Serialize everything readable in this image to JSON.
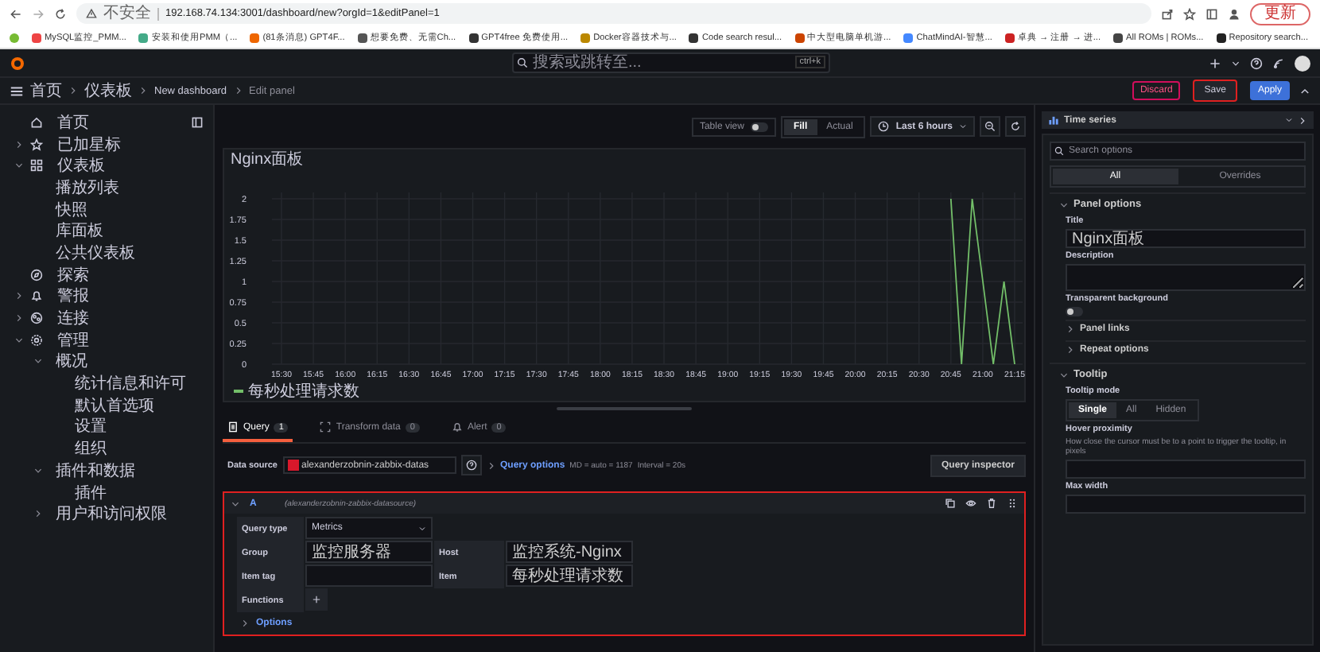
{
  "browser": {
    "security": "不安全",
    "url": "192.168.74.134:3001/dashboard/new?orgId=1&editPanel=1",
    "update_button": "更新",
    "bookmarks": [
      "MySQL监控_PMM...",
      "安装和使用PMM（...",
      "(81条消息) GPT4F...",
      "想要免费、无需Ch...",
      "GPT4free 免费使用...",
      "Docker容器技术与...",
      "Code search resul...",
      "中大型电脑单机游...",
      "ChatMindAI-智慧...",
      "卓典 → 注册 → 进...",
      "All ROMs | ROMs...",
      "Repository search..."
    ]
  },
  "topbar": {
    "search_placeholder": "搜索或跳转至...",
    "shortcut": "ctrl+k"
  },
  "breadcrumbs": [
    "首页",
    "仪表板",
    "New dashboard",
    "Edit panel"
  ],
  "header_actions": [
    {
      "label": "Discard",
      "kind": "destructive",
      "highlighted": false
    },
    {
      "label": "Save",
      "kind": "secondary",
      "highlighted": true
    },
    {
      "label": "Apply",
      "kind": "primary",
      "highlighted": false
    }
  ],
  "sidebar": {
    "items": [
      {
        "label": "首页",
        "kind": "home"
      },
      {
        "label": "已加星标",
        "kind": "star",
        "expanded": false
      },
      {
        "label": "仪表板",
        "kind": "grid",
        "expanded": true,
        "children": [
          {
            "label": "播放列表"
          },
          {
            "label": "快照"
          },
          {
            "label": "库面板"
          },
          {
            "label": "公共仪表板"
          }
        ]
      },
      {
        "label": "探索",
        "kind": "compass"
      },
      {
        "label": "警报",
        "kind": "bell",
        "expanded": false
      },
      {
        "label": "连接",
        "kind": "link",
        "expanded": false
      },
      {
        "label": "管理",
        "kind": "gear",
        "expanded": true,
        "children": [
          {
            "label": "概况",
            "expanded": true,
            "children": [
              {
                "label": "统计信息和许可"
              },
              {
                "label": "默认首选项"
              },
              {
                "label": "设置"
              },
              {
                "label": "组织"
              }
            ]
          },
          {
            "label": "插件和数据",
            "expanded": true,
            "children": [
              {
                "label": "插件"
              }
            ]
          },
          {
            "label": "用户和访问权限",
            "expanded": false
          }
        ]
      }
    ]
  },
  "toolbar": {
    "table_view": {
      "label": "Table view",
      "on": false
    },
    "size_modes": [
      {
        "label": "Fill",
        "selected": true
      },
      {
        "label": "Actual",
        "selected": false
      }
    ],
    "time_range": "Last 6 hours"
  },
  "panel": {
    "title": "Nginx面板",
    "chart_data": {
      "type": "line",
      "categories": [
        "15:30",
        null,
        null,
        "15:45",
        null,
        null,
        "16:00",
        null,
        null,
        "16:15",
        null,
        null,
        "16:30",
        null,
        null,
        "16:45",
        null,
        null,
        "17:00",
        null,
        null,
        "17:15",
        null,
        null,
        "17:30",
        null,
        null,
        "17:45",
        null,
        null,
        "18:00",
        null,
        null,
        "18:15",
        null,
        null,
        "18:30",
        null,
        null,
        "18:45",
        null,
        null,
        "19:00",
        null,
        null,
        "19:15",
        null,
        null,
        "19:30",
        null,
        null,
        "19:45",
        null,
        null,
        "20:00",
        null,
        null,
        "20:15",
        null,
        null,
        "20:30",
        null,
        null,
        "20:45",
        null,
        null,
        "21:00",
        null,
        null,
        "21:15"
      ],
      "series": [
        {
          "name": "每秒处理请求数",
          "color": "#73bf69",
          "values": [
            null,
            null,
            null,
            null,
            null,
            null,
            null,
            null,
            null,
            null,
            null,
            null,
            null,
            null,
            null,
            null,
            null,
            null,
            null,
            null,
            null,
            null,
            null,
            null,
            null,
            null,
            null,
            null,
            null,
            null,
            null,
            null,
            null,
            null,
            null,
            null,
            null,
            null,
            null,
            null,
            null,
            null,
            null,
            null,
            null,
            null,
            null,
            null,
            null,
            null,
            null,
            null,
            null,
            null,
            null,
            null,
            null,
            null,
            null,
            null,
            null,
            null,
            null,
            2,
            0,
            2,
            1,
            0,
            1,
            0
          ]
        }
      ],
      "ylim": [
        0,
        2
      ],
      "grid": true,
      "yticks": [
        0,
        0.25,
        0.5,
        0.75,
        1,
        1.25,
        1.5,
        1.75,
        2
      ]
    }
  },
  "query_editor": {
    "tabs": [
      {
        "label": "Query",
        "count": "1",
        "kind": "query",
        "selected": true
      },
      {
        "label": "Transform data",
        "count": "0",
        "kind": "transform",
        "selected": false
      },
      {
        "label": "Alert",
        "count": "0",
        "kind": "alert",
        "selected": false
      }
    ],
    "data_source": {
      "label": "Data source",
      "value": "alexanderzobnin-zabbix-datas",
      "query_options": "Query options",
      "max_data_points": "MD = auto = 1187",
      "interval": "Interval = 20s",
      "inspector": "Query inspector"
    },
    "query": {
      "ref": "A",
      "source": "(alexanderzobnin-zabbix-datasource)",
      "expanded": true,
      "highlighted": true,
      "query_type": {
        "label": "Query type",
        "value": "Metrics"
      },
      "field_rows": [
        [
          {
            "label": "Group",
            "value": "监控服务器"
          },
          {
            "label": "Host",
            "value": "监控系统-Nginx"
          }
        ],
        [
          {
            "label": "Item tag"
          },
          {
            "label": "Item",
            "value": "每秒处理请求数"
          }
        ]
      ],
      "functions": "Functions",
      "options": "Options"
    }
  },
  "options_pane": {
    "visualization": "Time series",
    "search_placeholder": "Search options",
    "tabs": [
      {
        "label": "All",
        "selected": true
      },
      {
        "label": "Overrides",
        "selected": false
      }
    ],
    "sections": [
      {
        "title": "Panel options",
        "expanded": true,
        "items": [
          {
            "kind": "input",
            "label": "Title",
            "value": "Nginx面板"
          },
          {
            "kind": "textarea",
            "label": "Description"
          },
          {
            "kind": "switch",
            "label": "Transparent background",
            "on": false
          },
          {
            "kind": "group",
            "label": "Panel links",
            "expanded": false
          },
          {
            "kind": "group",
            "label": "Repeat options",
            "expanded": false
          }
        ]
      },
      {
        "title": "Tooltip",
        "expanded": true,
        "items": [
          {
            "kind": "radio",
            "label": "Tooltip mode",
            "options": [
              {
                "label": "Single",
                "selected": true
              },
              {
                "label": "All",
                "selected": false
              },
              {
                "label": "Hidden",
                "selected": false
              }
            ]
          },
          {
            "kind": "input",
            "label": "Hover proximity",
            "description": "How close the cursor must be to a point to trigger the tooltip, in pixels"
          },
          {
            "kind": "input",
            "label": "Max width"
          }
        ]
      }
    ]
  }
}
